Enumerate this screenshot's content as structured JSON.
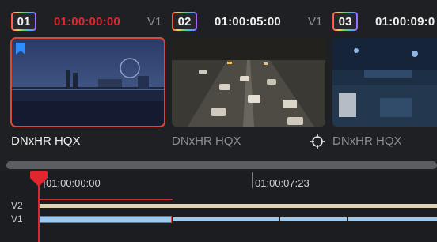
{
  "clips": [
    {
      "number": "01",
      "timecode": "01:00:00:00",
      "track": "V1",
      "codec": "DNxHR HQX",
      "selected": true
    },
    {
      "number": "02",
      "timecode": "01:00:05:00",
      "track": "V1",
      "codec": "DNxHR HQX",
      "selected": false
    },
    {
      "number": "03",
      "timecode": "01:00:09:0",
      "codec": "DNxHR HQX",
      "selected": false
    }
  ],
  "timeline": {
    "ruler_timecodes": [
      "01:00:00:00",
      "01:00:07:23"
    ],
    "tracks": [
      "V2",
      "V1"
    ],
    "playhead_timecode_index": 0
  },
  "colors": {
    "active_timecode": "#e0262f",
    "selection_outline": "#d94a3a",
    "clip_bar": "#9dc9ef",
    "v2_bar": "#e0d3b8",
    "playhead": "#e0262f"
  },
  "icons": {
    "flag": "bookmark-flag-icon",
    "viewer": "crosshair-icon",
    "playhead": "playhead-marker-icon"
  }
}
